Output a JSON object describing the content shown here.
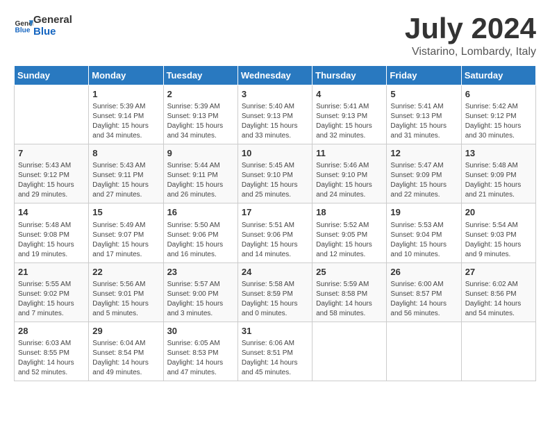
{
  "header": {
    "logo_line1": "General",
    "logo_line2": "Blue",
    "title": "July 2024",
    "subtitle": "Vistarino, Lombardy, Italy"
  },
  "days_of_week": [
    "Sunday",
    "Monday",
    "Tuesday",
    "Wednesday",
    "Thursday",
    "Friday",
    "Saturday"
  ],
  "weeks": [
    [
      {
        "num": "",
        "info": ""
      },
      {
        "num": "1",
        "info": "Sunrise: 5:39 AM\nSunset: 9:14 PM\nDaylight: 15 hours\nand 34 minutes."
      },
      {
        "num": "2",
        "info": "Sunrise: 5:39 AM\nSunset: 9:13 PM\nDaylight: 15 hours\nand 34 minutes."
      },
      {
        "num": "3",
        "info": "Sunrise: 5:40 AM\nSunset: 9:13 PM\nDaylight: 15 hours\nand 33 minutes."
      },
      {
        "num": "4",
        "info": "Sunrise: 5:41 AM\nSunset: 9:13 PM\nDaylight: 15 hours\nand 32 minutes."
      },
      {
        "num": "5",
        "info": "Sunrise: 5:41 AM\nSunset: 9:13 PM\nDaylight: 15 hours\nand 31 minutes."
      },
      {
        "num": "6",
        "info": "Sunrise: 5:42 AM\nSunset: 9:12 PM\nDaylight: 15 hours\nand 30 minutes."
      }
    ],
    [
      {
        "num": "7",
        "info": "Sunrise: 5:43 AM\nSunset: 9:12 PM\nDaylight: 15 hours\nand 29 minutes."
      },
      {
        "num": "8",
        "info": "Sunrise: 5:43 AM\nSunset: 9:11 PM\nDaylight: 15 hours\nand 27 minutes."
      },
      {
        "num": "9",
        "info": "Sunrise: 5:44 AM\nSunset: 9:11 PM\nDaylight: 15 hours\nand 26 minutes."
      },
      {
        "num": "10",
        "info": "Sunrise: 5:45 AM\nSunset: 9:10 PM\nDaylight: 15 hours\nand 25 minutes."
      },
      {
        "num": "11",
        "info": "Sunrise: 5:46 AM\nSunset: 9:10 PM\nDaylight: 15 hours\nand 24 minutes."
      },
      {
        "num": "12",
        "info": "Sunrise: 5:47 AM\nSunset: 9:09 PM\nDaylight: 15 hours\nand 22 minutes."
      },
      {
        "num": "13",
        "info": "Sunrise: 5:48 AM\nSunset: 9:09 PM\nDaylight: 15 hours\nand 21 minutes."
      }
    ],
    [
      {
        "num": "14",
        "info": "Sunrise: 5:48 AM\nSunset: 9:08 PM\nDaylight: 15 hours\nand 19 minutes."
      },
      {
        "num": "15",
        "info": "Sunrise: 5:49 AM\nSunset: 9:07 PM\nDaylight: 15 hours\nand 17 minutes."
      },
      {
        "num": "16",
        "info": "Sunrise: 5:50 AM\nSunset: 9:06 PM\nDaylight: 15 hours\nand 16 minutes."
      },
      {
        "num": "17",
        "info": "Sunrise: 5:51 AM\nSunset: 9:06 PM\nDaylight: 15 hours\nand 14 minutes."
      },
      {
        "num": "18",
        "info": "Sunrise: 5:52 AM\nSunset: 9:05 PM\nDaylight: 15 hours\nand 12 minutes."
      },
      {
        "num": "19",
        "info": "Sunrise: 5:53 AM\nSunset: 9:04 PM\nDaylight: 15 hours\nand 10 minutes."
      },
      {
        "num": "20",
        "info": "Sunrise: 5:54 AM\nSunset: 9:03 PM\nDaylight: 15 hours\nand 9 minutes."
      }
    ],
    [
      {
        "num": "21",
        "info": "Sunrise: 5:55 AM\nSunset: 9:02 PM\nDaylight: 15 hours\nand 7 minutes."
      },
      {
        "num": "22",
        "info": "Sunrise: 5:56 AM\nSunset: 9:01 PM\nDaylight: 15 hours\nand 5 minutes."
      },
      {
        "num": "23",
        "info": "Sunrise: 5:57 AM\nSunset: 9:00 PM\nDaylight: 15 hours\nand 3 minutes."
      },
      {
        "num": "24",
        "info": "Sunrise: 5:58 AM\nSunset: 8:59 PM\nDaylight: 15 hours\nand 0 minutes."
      },
      {
        "num": "25",
        "info": "Sunrise: 5:59 AM\nSunset: 8:58 PM\nDaylight: 14 hours\nand 58 minutes."
      },
      {
        "num": "26",
        "info": "Sunrise: 6:00 AM\nSunset: 8:57 PM\nDaylight: 14 hours\nand 56 minutes."
      },
      {
        "num": "27",
        "info": "Sunrise: 6:02 AM\nSunset: 8:56 PM\nDaylight: 14 hours\nand 54 minutes."
      }
    ],
    [
      {
        "num": "28",
        "info": "Sunrise: 6:03 AM\nSunset: 8:55 PM\nDaylight: 14 hours\nand 52 minutes."
      },
      {
        "num": "29",
        "info": "Sunrise: 6:04 AM\nSunset: 8:54 PM\nDaylight: 14 hours\nand 49 minutes."
      },
      {
        "num": "30",
        "info": "Sunrise: 6:05 AM\nSunset: 8:53 PM\nDaylight: 14 hours\nand 47 minutes."
      },
      {
        "num": "31",
        "info": "Sunrise: 6:06 AM\nSunset: 8:51 PM\nDaylight: 14 hours\nand 45 minutes."
      },
      {
        "num": "",
        "info": ""
      },
      {
        "num": "",
        "info": ""
      },
      {
        "num": "",
        "info": ""
      }
    ]
  ]
}
